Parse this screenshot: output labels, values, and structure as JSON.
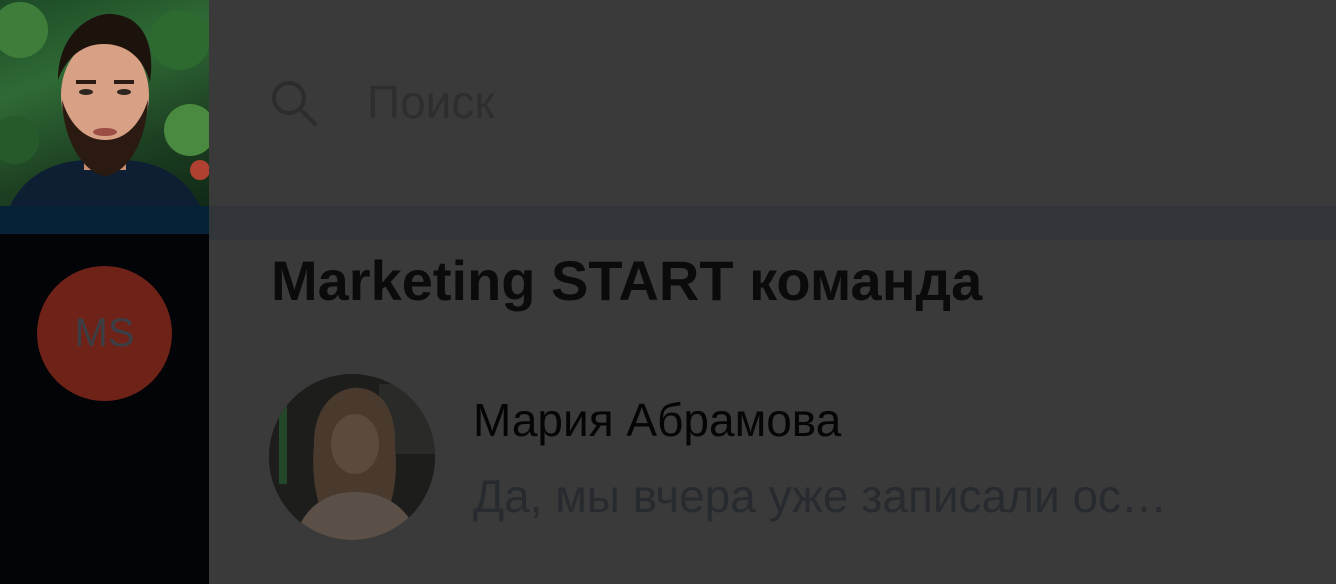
{
  "search": {
    "placeholder": "Поиск"
  },
  "accounts": [
    {
      "type": "photo",
      "active": true,
      "icon": "user-photo-avatar"
    },
    {
      "type": "initials",
      "initials": "MS",
      "color": "#6e2218"
    }
  ],
  "section": {
    "title": "Marketing START команда"
  },
  "chats": [
    {
      "name": "Мария Абрамова",
      "preview": "Да, мы вчера уже записали ос…",
      "icon": "user-photo-avatar"
    }
  ],
  "colors": {
    "rail_bg": "#030407",
    "main_bg": "#3a3a3a",
    "active_indicator": "#ffffff"
  }
}
